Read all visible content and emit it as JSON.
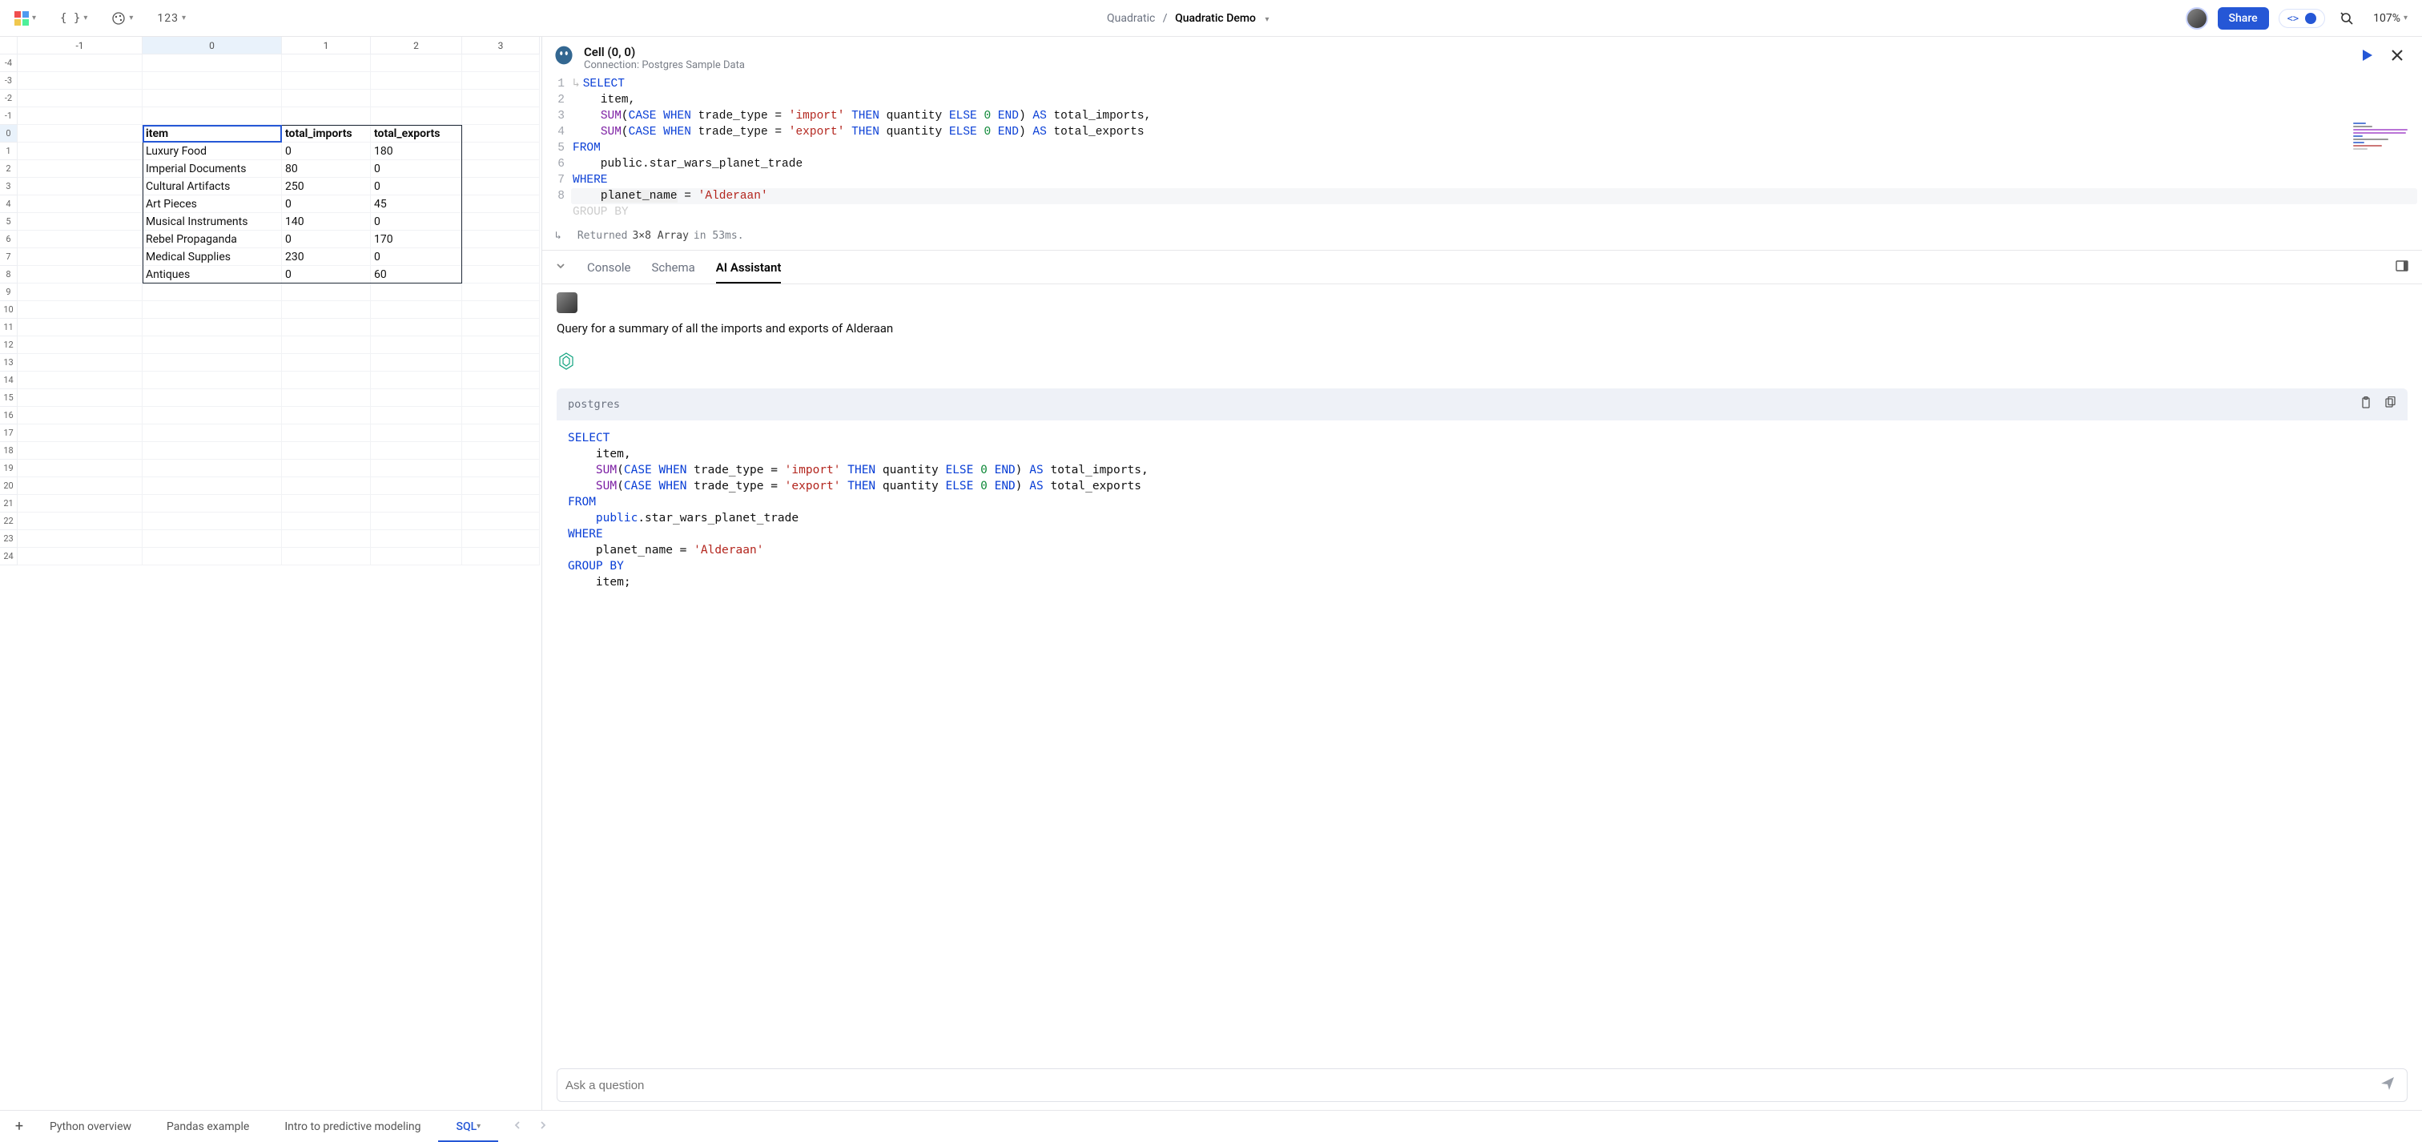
{
  "toolbar": {
    "format_number": "123"
  },
  "breadcrumb": {
    "root": "Quadratic",
    "sep": "/",
    "current": "Quadratic Demo"
  },
  "topright": {
    "share": "Share",
    "zoom": "107%"
  },
  "sheet": {
    "col_headers": [
      "-1",
      "0",
      "1",
      "2",
      "3"
    ],
    "row_headers": [
      "-4",
      "-3",
      "-2",
      "-1",
      "0",
      "1",
      "2",
      "3",
      "4",
      "5",
      "6",
      "7",
      "8",
      "9",
      "10",
      "11",
      "12",
      "13",
      "14",
      "15",
      "16",
      "17",
      "18",
      "19",
      "20",
      "21",
      "22",
      "23",
      "24"
    ],
    "data": [
      [
        "item",
        "total_imports",
        "total_exports"
      ],
      [
        "Luxury Food",
        "0",
        "180"
      ],
      [
        "Imperial Documents",
        "80",
        "0"
      ],
      [
        "Cultural Artifacts",
        "250",
        "0"
      ],
      [
        "Art Pieces",
        "0",
        "45"
      ],
      [
        "Musical Instruments",
        "140",
        "0"
      ],
      [
        "Rebel Propaganda",
        "0",
        "170"
      ],
      [
        "Medical Supplies",
        "230",
        "0"
      ],
      [
        "Antiques",
        "0",
        "60"
      ]
    ]
  },
  "code": {
    "title": "Cell (0, 0)",
    "subtitle": "Connection: Postgres Sample Data",
    "lines": [
      {
        "n": "1",
        "html": "<span class='kw'>SELECT</span>"
      },
      {
        "n": "2",
        "html": "    item,"
      },
      {
        "n": "3",
        "html": "    <span class='fn'>SUM</span>(<span class='kw'>CASE</span> <span class='kw'>WHEN</span> trade_type = <span class='str'>'import'</span> <span class='kw'>THEN</span> quantity <span class='kw'>ELSE</span> <span class='num'>0</span> <span class='kw'>END</span>) <span class='kw'>AS</span> total_imports,"
      },
      {
        "n": "4",
        "html": "    <span class='fn'>SUM</span>(<span class='kw'>CASE</span> <span class='kw'>WHEN</span> trade_type = <span class='str'>'export'</span> <span class='kw'>THEN</span> quantity <span class='kw'>ELSE</span> <span class='num'>0</span> <span class='kw'>END</span>) <span class='kw'>AS</span> total_exports"
      },
      {
        "n": "5",
        "html": "<span class='kw'>FROM</span>"
      },
      {
        "n": "6",
        "html": "    public.star_wars_planet_trade"
      },
      {
        "n": "7",
        "html": "<span class='kw'>WHERE</span>"
      },
      {
        "n": "8",
        "html": "    <span class='hl'>planet_name</span> = <span class='str'>'Alderaan'</span>"
      },
      {
        "n": "",
        "html": "<span style='color:#ccc'>GROUP BY</span>"
      }
    ],
    "returned_prefix": "Returned",
    "returned_val": "3×8 Array",
    "returned_suffix": "in 53ms."
  },
  "tabs": {
    "console": "Console",
    "schema": "Schema",
    "ai": "AI Assistant"
  },
  "chat": {
    "user_msg": "Query for a summary of all the imports and exports of Alderaan",
    "codeblock_lang": "postgres",
    "ai_code_html": "<span class='kw'>SELECT</span>\n    item,\n    <span class='fn'>SUM</span>(<span class='kw'>CASE</span> <span class='kw'>WHEN</span> trade_type = <span class='str'>'import'</span> <span class='kw'>THEN</span> quantity <span class='kw'>ELSE</span> <span class='num'>0</span> <span class='kw'>END</span>) <span class='kw'>AS</span> total_imports,\n    <span class='fn'>SUM</span>(<span class='kw'>CASE</span> <span class='kw'>WHEN</span> trade_type = <span class='str'>'export'</span> <span class='kw'>THEN</span> quantity <span class='kw'>ELSE</span> <span class='num'>0</span> <span class='kw'>END</span>) <span class='kw'>AS</span> total_exports\n<span class='kw'>FROM</span>\n    <span class='kw'>public</span>.star_wars_planet_trade\n<span class='kw'>WHERE</span>\n    planet_name = <span class='str'>'Alderaan'</span>\n<span class='kw'>GROUP BY</span>\n    item;",
    "input_placeholder": "Ask a question"
  },
  "sheets": {
    "tabs": [
      "Python overview",
      "Pandas example",
      "Intro to predictive modeling",
      "SQL"
    ],
    "active": 3
  }
}
